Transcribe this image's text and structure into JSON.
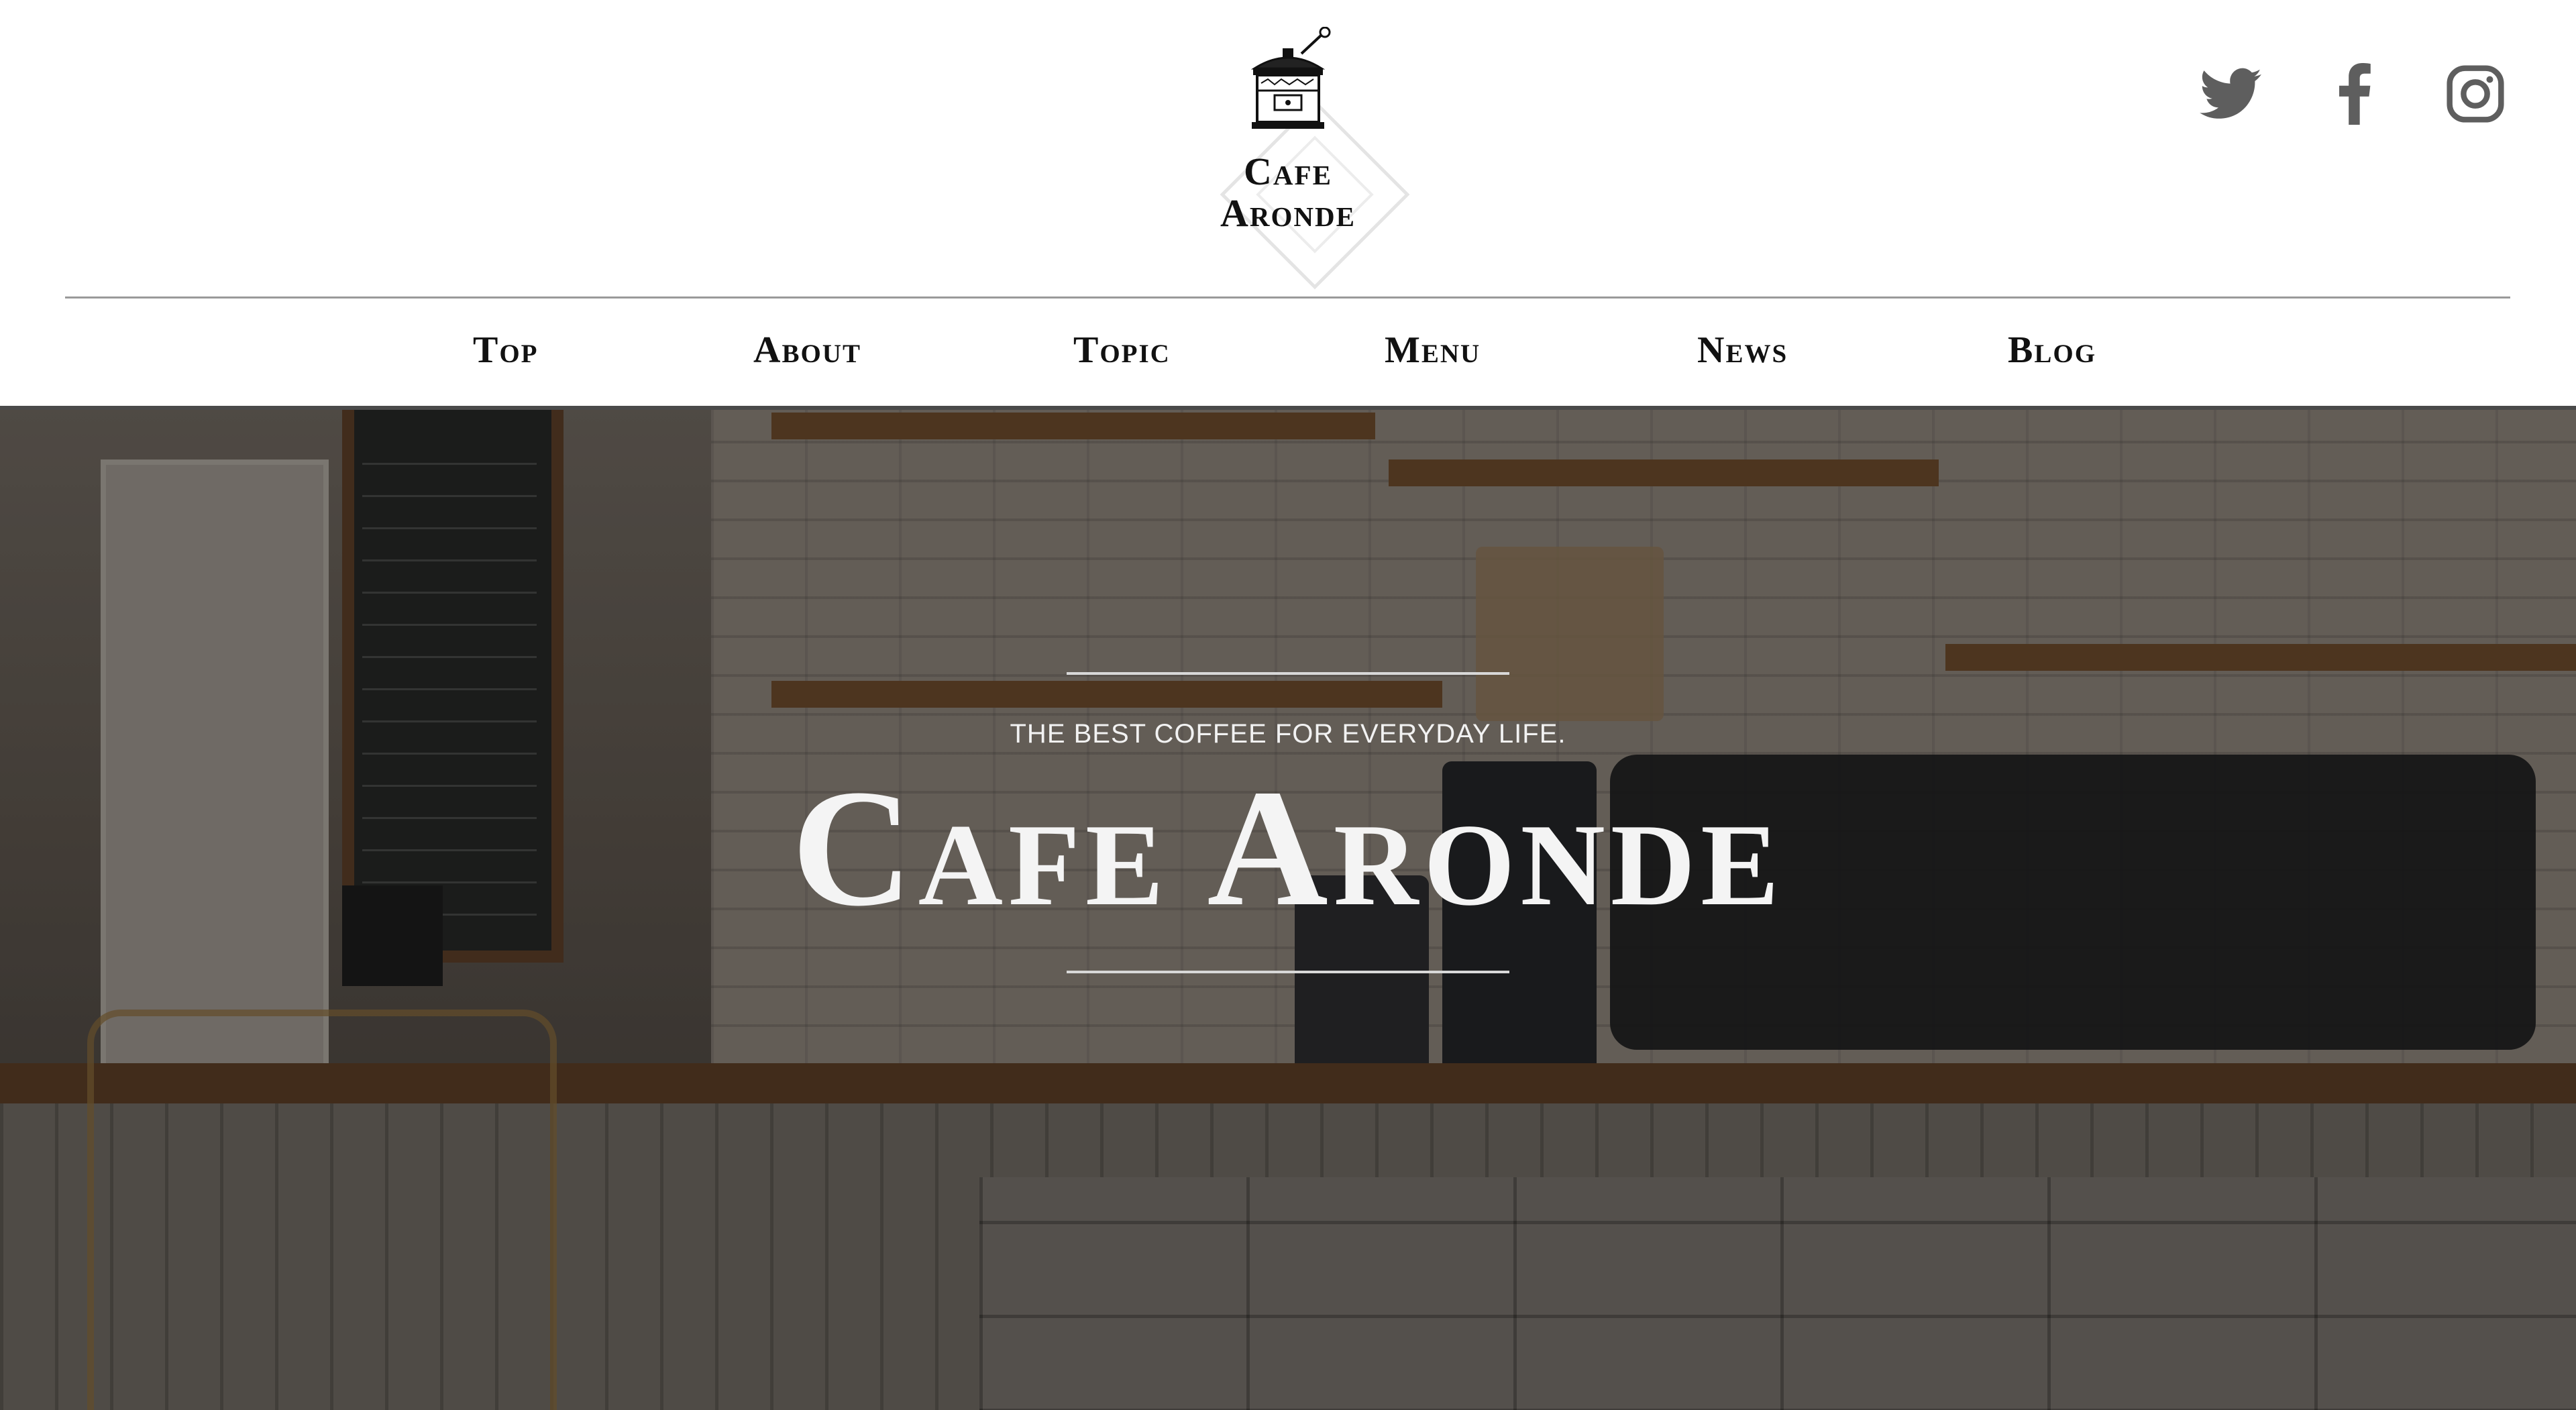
{
  "brand": {
    "line1": "Cafe",
    "line2": "Aronde"
  },
  "social": [
    {
      "icon": "twitter-icon"
    },
    {
      "icon": "facebook-icon"
    },
    {
      "icon": "instagram-icon"
    }
  ],
  "nav": {
    "items": [
      {
        "label": "Top"
      },
      {
        "label": "About"
      },
      {
        "label": "Topic"
      },
      {
        "label": "Menu"
      },
      {
        "label": "News"
      },
      {
        "label": "Blog"
      }
    ]
  },
  "hero": {
    "tagline": "THE BEST COFFEE FOR EVERYDAY LIFE.",
    "title": "Cafe Aronde"
  },
  "colors": {
    "icon_gray": "#5e5e5e",
    "divider": "#9a9a9a",
    "hero_text": "#f4f4f4"
  }
}
